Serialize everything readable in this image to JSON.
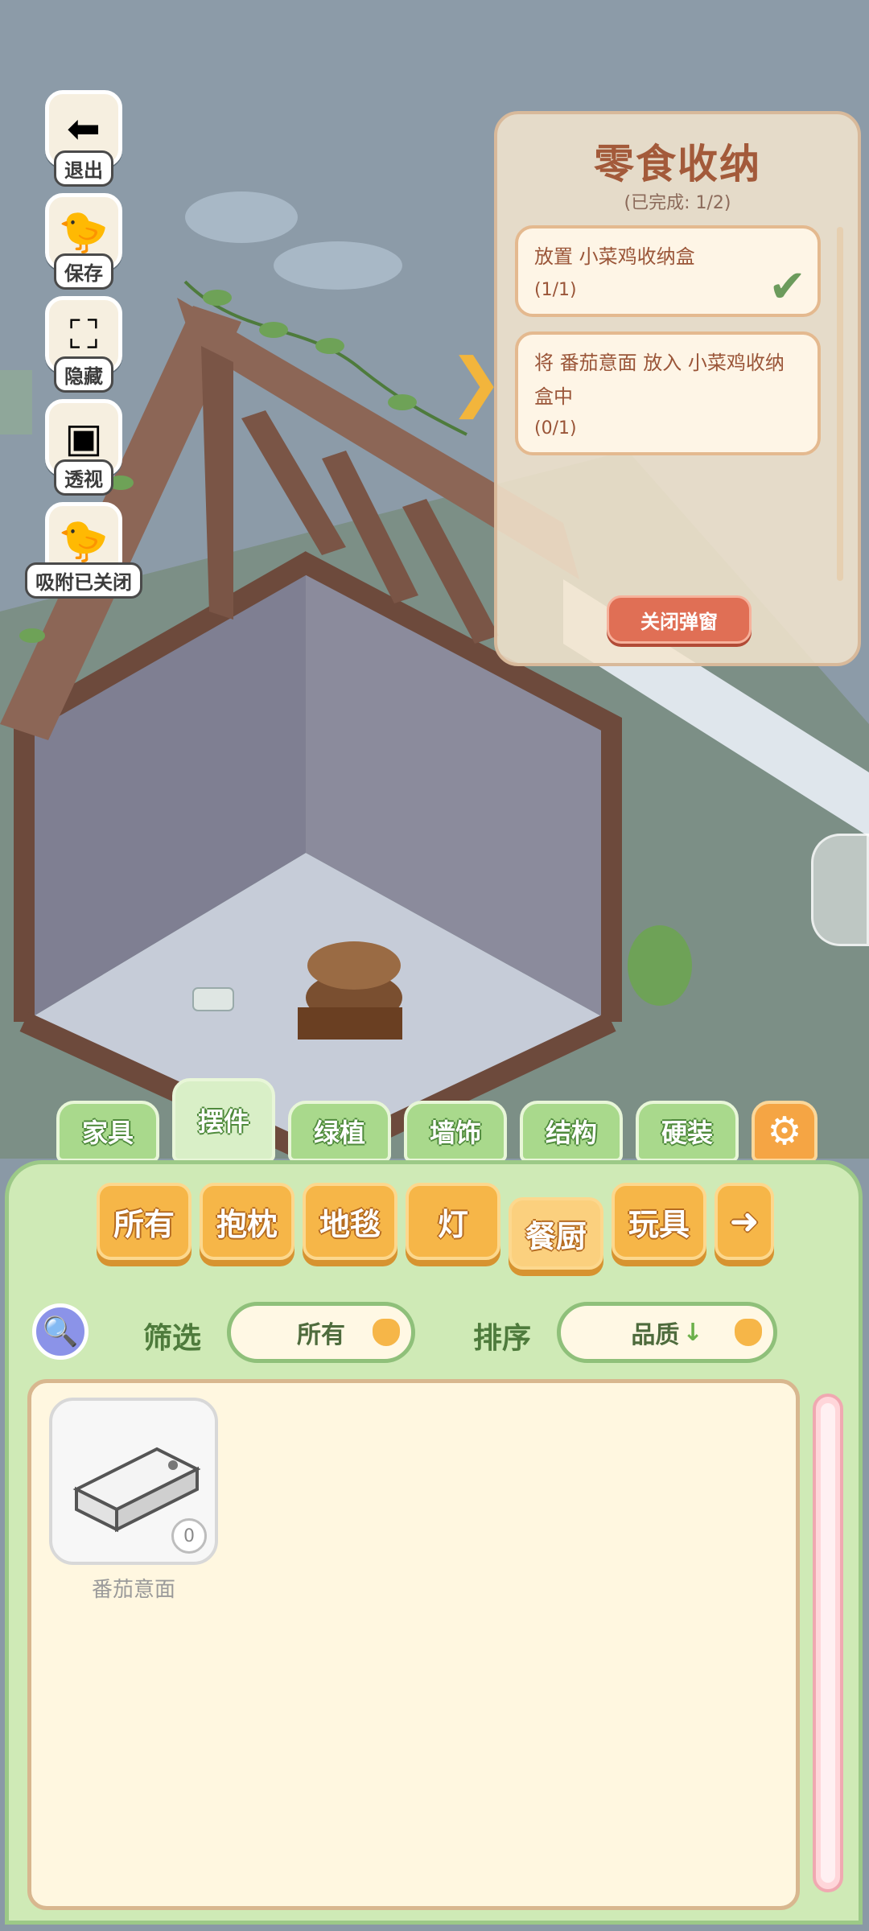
{
  "tools": [
    {
      "label": "退出",
      "icon": "exit-icon"
    },
    {
      "label": "保存",
      "icon": "save-icon"
    },
    {
      "label": "隐藏",
      "icon": "hide-icon"
    },
    {
      "label": "透视",
      "icon": "perspective-icon"
    },
    {
      "label": "吸附已关闭",
      "icon": "snap-icon"
    }
  ],
  "quest": {
    "title": "零食收纳",
    "subtitle": "(已完成: 1/2)",
    "tasks": [
      {
        "text": "放置 小菜鸡收纳盒",
        "progress": "(1/1)",
        "done": true
      },
      {
        "text": "将 番茄意面 放入 小菜鸡收纳盒中",
        "progress": "(0/1)",
        "done": false
      }
    ],
    "close_label": "关闭弹窗"
  },
  "categories": [
    "家具",
    "摆件",
    "绿植",
    "墙饰",
    "结构",
    "硬装"
  ],
  "active_category": "摆件",
  "subcategories": [
    "所有",
    "抱枕",
    "地毯",
    "灯",
    "餐厨",
    "玩具"
  ],
  "active_subcategory": "餐厨",
  "filter": {
    "label": "筛选",
    "value": "所有"
  },
  "sort": {
    "label": "排序",
    "value": "品质",
    "arrow": "↓"
  },
  "items": [
    {
      "name": "番茄意面",
      "count": "0"
    }
  ],
  "colors": {
    "panel": "#cfeab6",
    "tab_green": "#a9d98c",
    "orange": "#f6b648",
    "popup_title": "#a35a3a"
  }
}
